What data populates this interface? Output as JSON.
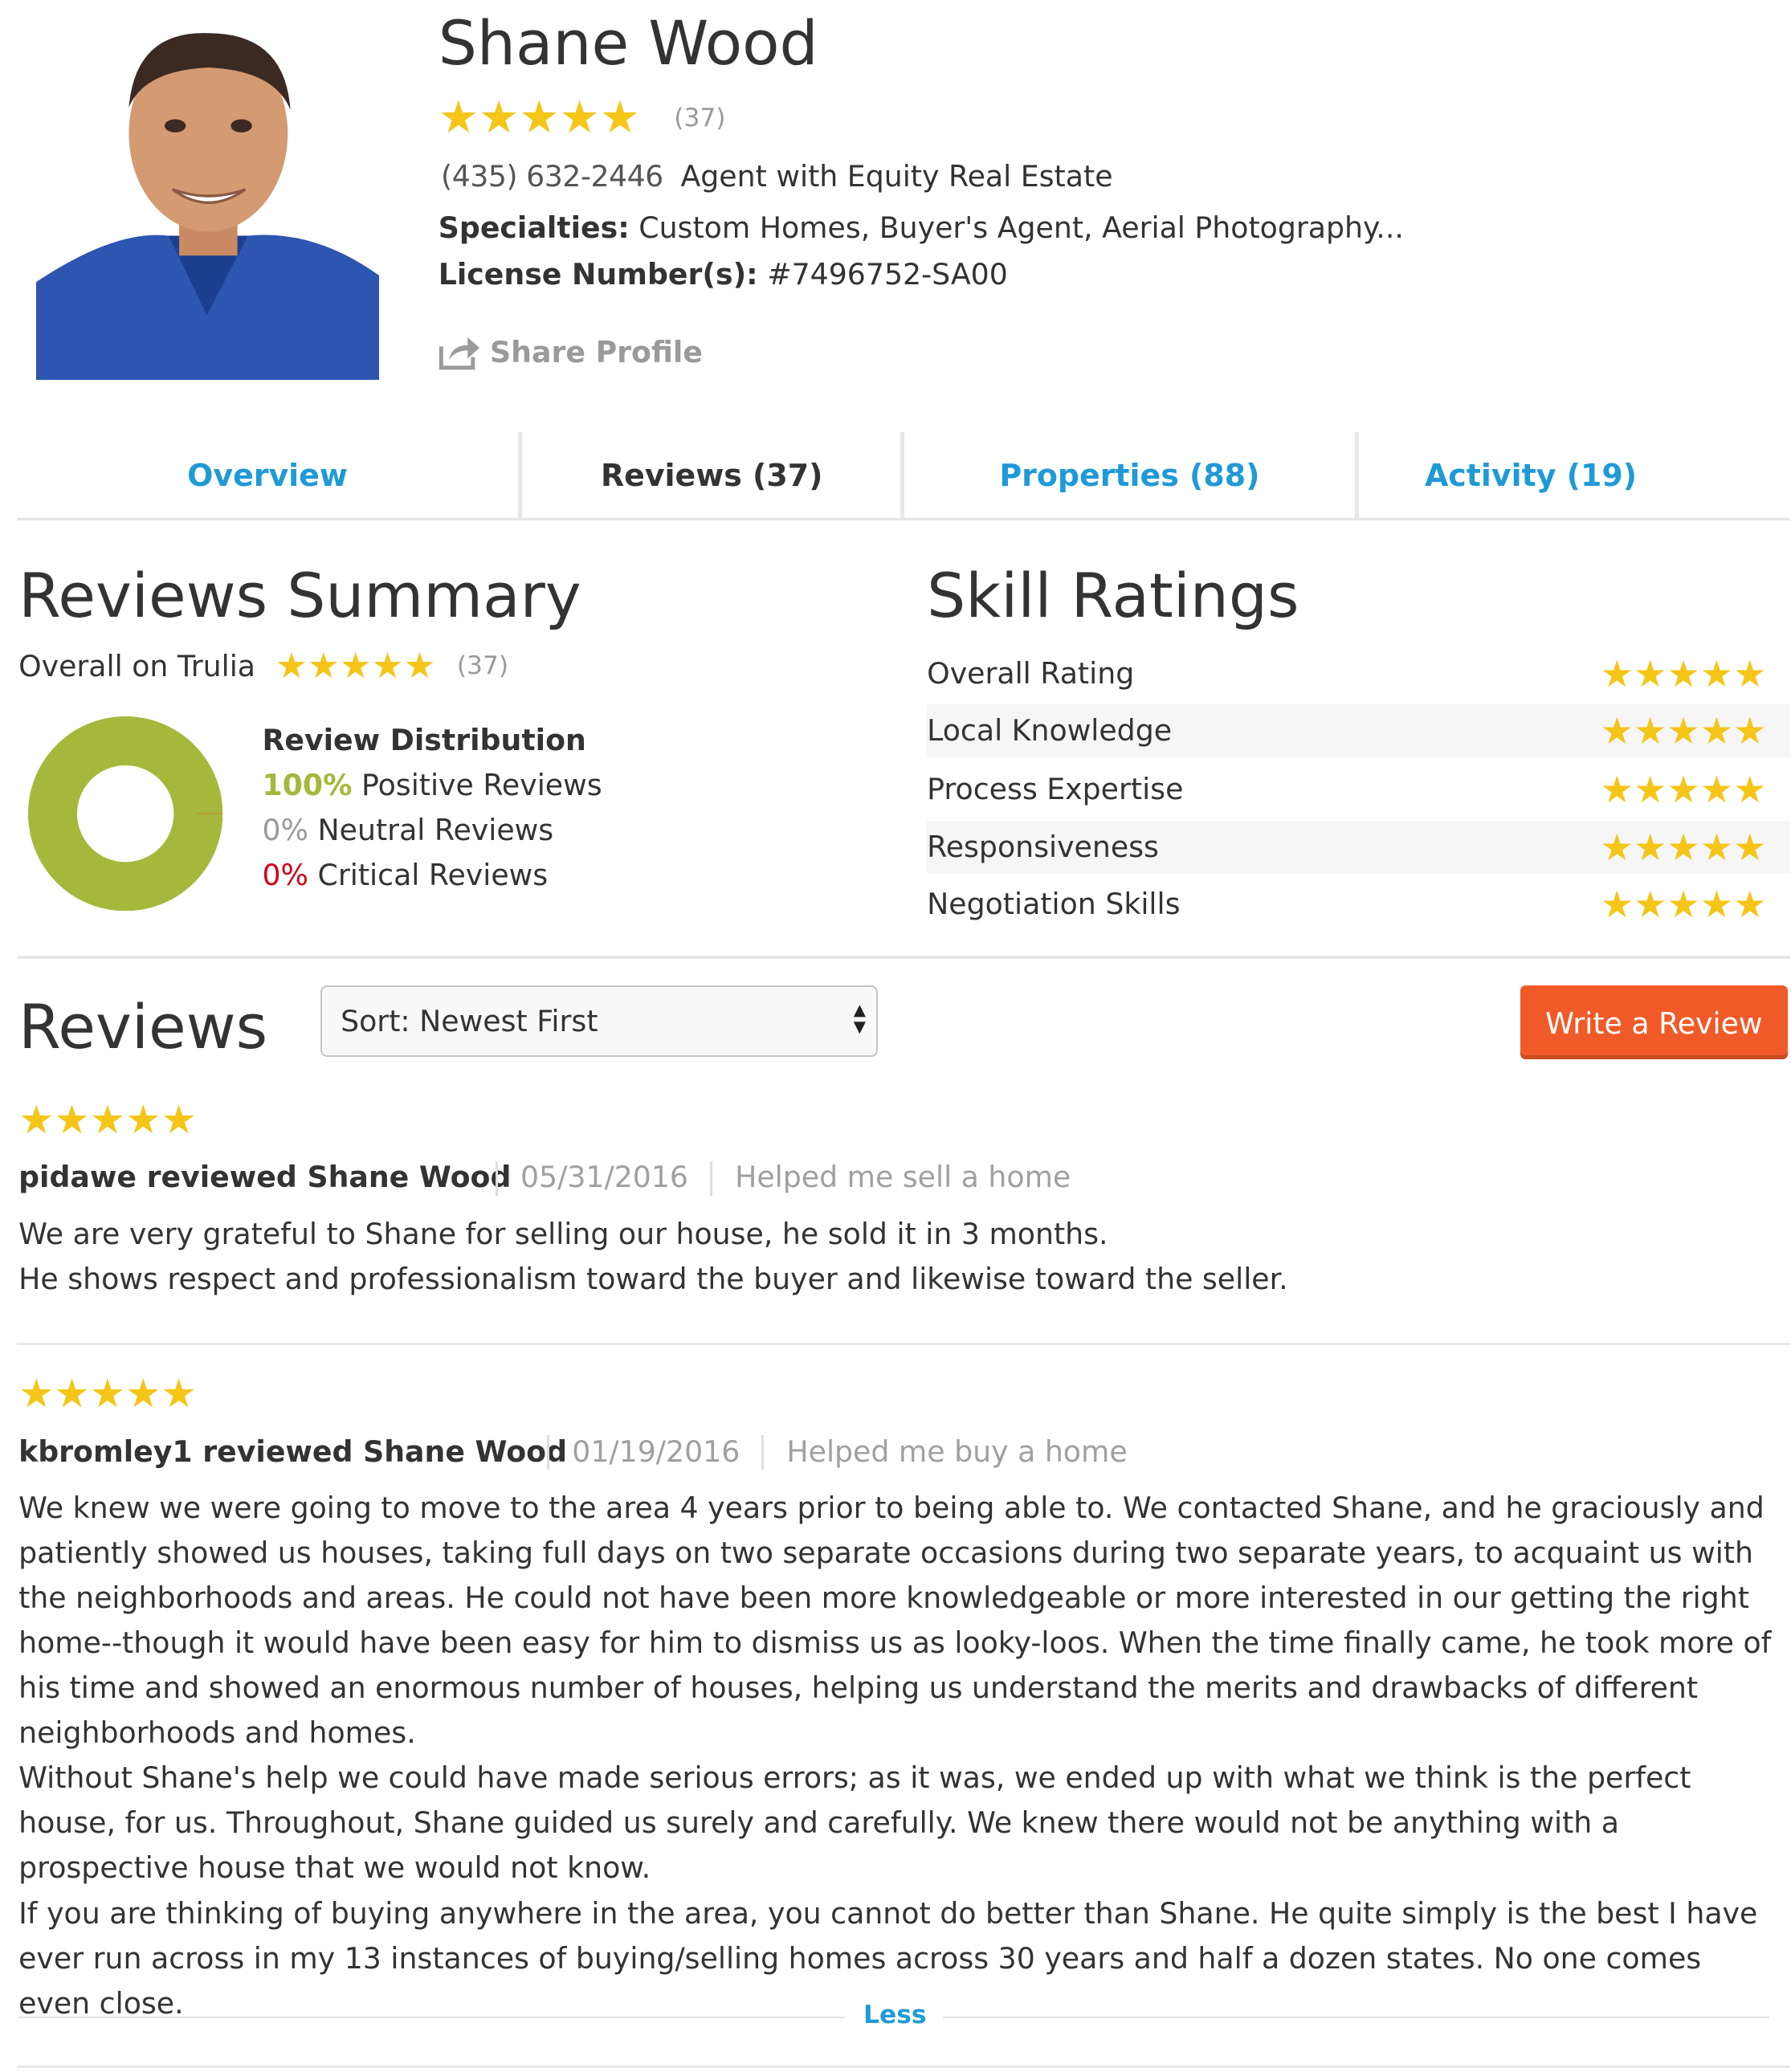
{
  "agent": {
    "name": "Shane Wood",
    "rating_count": "(37)",
    "phone": "(435) 632-2446",
    "company": "Agent with Equity Real Estate",
    "specialties_label": "Specialties:",
    "specialties_value": "Custom Homes, Buyer's Agent, Aerial Photography...",
    "license_label": "License Number(s):",
    "license_value": "#7496752-SA00",
    "share_label": "Share Profile"
  },
  "tabs": [
    {
      "label": "Overview"
    },
    {
      "label": "Reviews (37)"
    },
    {
      "label": "Properties (88)"
    },
    {
      "label": "Activity (19)"
    }
  ],
  "summary": {
    "title": "Reviews Summary",
    "overall_label": "Overall on Trulia",
    "overall_count": "(37)",
    "distribution_title": "Review Distribution",
    "positive_pct": "100%",
    "positive_label": "Positive Reviews",
    "neutral_pct": "0%",
    "neutral_label": "Neutral Reviews",
    "critical_pct": "0%",
    "critical_label": "Critical Reviews",
    "positive_fraction": 1.0
  },
  "skills": {
    "title": "Skill Ratings",
    "items": [
      {
        "label": "Overall Rating",
        "stars": 5
      },
      {
        "label": "Local Knowledge",
        "stars": 5
      },
      {
        "label": "Process Expertise",
        "stars": 5
      },
      {
        "label": "Responsiveness",
        "stars": 5
      },
      {
        "label": "Negotiation Skills",
        "stars": 5
      }
    ]
  },
  "reviews_section": {
    "title": "Reviews",
    "sort_value": "Sort: Newest First",
    "write_label": "Write a Review",
    "less_label": "Less"
  },
  "reviews": [
    {
      "stars": 5,
      "title": "pidawe reviewed Shane Wood",
      "date": "05/31/2016",
      "tag": "Helped me sell a home",
      "paragraphs": [
        "We are very grateful to Shane for selling our house, he sold it in 3 months.",
        "He shows respect and professionalism toward the buyer and likewise toward the seller."
      ]
    },
    {
      "stars": 5,
      "title": "kbromley1 reviewed Shane Wood",
      "date": "01/19/2016",
      "tag": "Helped me buy a home",
      "paragraphs": [
        "We knew we were going to move to the area 4 years prior to being able to. We contacted Shane, and he graciously and patiently showed us houses, taking full days on two separate occasions during two separate years, to acquaint us with the neighborhoods and areas. He could not have been more knowledgeable or more interested in our getting the right home--though it would have been easy for him to dismiss us as looky-loos. When the time finally came, he took more of his time and showed an enormous number of houses, helping us understand the merits and drawbacks of different neighborhoods and homes.",
        "Without Shane's help we could have made serious errors; as it was, we ended up with what we think is the perfect house, for us. Throughout, Shane guided us surely and carefully. We knew there would not be anything with a prospective house that we would not know.",
        "If you are thinking of buying anywhere in the area, you cannot do better than Shane. He quite simply is the best I have ever run across in my 13 instances of buying/selling homes across 30 years and half a dozen states. No one comes even close."
      ]
    }
  ],
  "colors": {
    "star": "#f5c517",
    "link_blue": "#1f9ad6",
    "positive_green": "#a6b83c",
    "critical_red": "#d0021b",
    "cta_orange": "#f05a28"
  },
  "icons": [
    "star-icon",
    "share-icon",
    "sort-arrows-icon"
  ]
}
